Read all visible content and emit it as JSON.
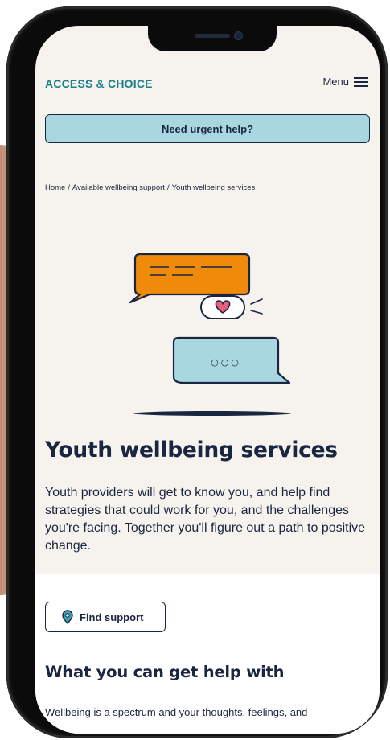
{
  "header": {
    "brand": "ACCESS & CHOICE",
    "menu_label": "Menu"
  },
  "urgent": {
    "label": "Need urgent help?"
  },
  "breadcrumb": {
    "items": [
      "Home",
      "Available wellbeing support",
      "Youth wellbeing services"
    ],
    "separator": "/"
  },
  "illustration": {
    "bubble_dots": "○○○"
  },
  "page": {
    "title": "Youth wellbeing services",
    "intro": "Youth providers will get to know you, and help find strategies that could work for you, and the challenges you're facing. Together you'll figure out a path to positive change."
  },
  "actions": {
    "find_support": "Find support"
  },
  "section": {
    "heading": "What you can get help with",
    "body": "Wellbeing is a spectrum and your thoughts, feelings, and"
  },
  "colors": {
    "brand": "#1c8089",
    "navy": "#1a2540",
    "urgent_bg": "#a8d7e0",
    "page_bg": "#f6f3ee",
    "orange": "#f08a0a",
    "heart": "#e8607a"
  },
  "icons": {
    "menu": "hamburger-icon",
    "find_support": "map-pin-icon",
    "heart": "heart-icon"
  }
}
